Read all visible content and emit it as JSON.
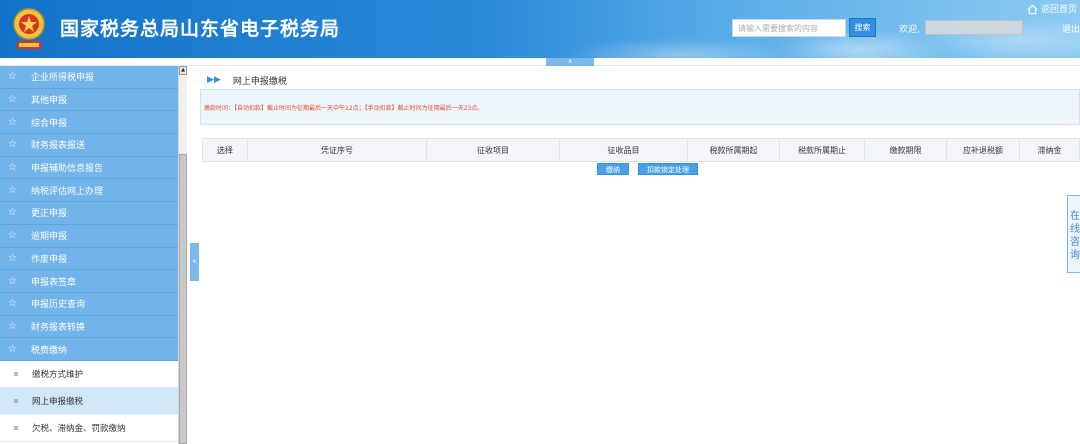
{
  "header": {
    "site_title": "国家税务总局山东省电子税务局",
    "search_placeholder": "请输入需要搜索的内容",
    "search_label": "搜索",
    "welcome": "欢迎,",
    "home_label": "返回首页",
    "logout_label": "退出",
    "collapse_label": "∧"
  },
  "sidebar": {
    "items": [
      {
        "label": "企业所得税申报"
      },
      {
        "label": "其他申报"
      },
      {
        "label": "综合申报"
      },
      {
        "label": "财务报表报送"
      },
      {
        "label": "申报辅助信息报告"
      },
      {
        "label": "纳税评估网上办理"
      },
      {
        "label": "更正申报"
      },
      {
        "label": "逾期申报"
      },
      {
        "label": "作废申报"
      },
      {
        "label": "申报表签章"
      },
      {
        "label": "申报历史查询"
      },
      {
        "label": "财务报表转换"
      },
      {
        "label": "税费缴纳"
      }
    ],
    "sub_items": [
      {
        "label": "缴税方式维护"
      },
      {
        "label": "网上申报缴税"
      },
      {
        "label": "欠税、滞纳金、罚款缴纳"
      }
    ],
    "toggle_label": "<"
  },
  "main": {
    "page_title": "网上申报缴税",
    "notice": "缴款时间：【自动扣款】截止时间为征期最后一天中午12点；【手动扣款】截止时间为征期最后一天23点。",
    "columns": [
      "选择",
      "凭证序号",
      "征收项目",
      "征收品目",
      "税款所属期起",
      "税款所属期止",
      "缴款期限",
      "应补退税额",
      "滞纳金"
    ],
    "buttons": {
      "pay": "缴纳",
      "lock": "扣款锁定处理"
    },
    "side_tab": "在线咨询"
  },
  "colors": {
    "header_blue": "#1172c9",
    "sidebar_blue": "#72b3ea",
    "notice_red": "#e04d2a",
    "button_blue": "#4aa0e6"
  }
}
